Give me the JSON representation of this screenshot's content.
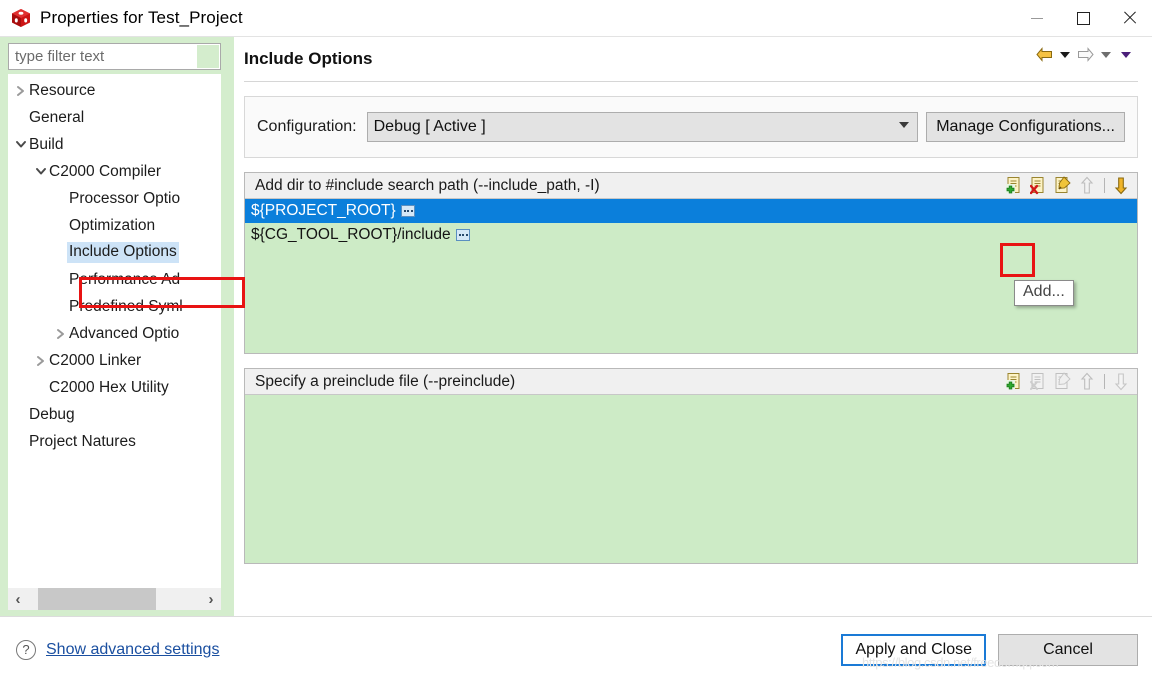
{
  "window": {
    "title": "Properties for Test_Project",
    "app_icon": "red-cube-icon",
    "controls": {
      "minimize": "minimize-icon",
      "maximize": "maximize-icon",
      "close": "close-icon"
    }
  },
  "sidebar": {
    "filter": {
      "placeholder": "type filter text",
      "value": ""
    },
    "tree": [
      {
        "label": "Resource",
        "indent": 0,
        "arrow": "collapsed",
        "selected": false
      },
      {
        "label": "General",
        "indent": 0,
        "arrow": "none",
        "selected": false
      },
      {
        "label": "Build",
        "indent": 0,
        "arrow": "expanded",
        "selected": false
      },
      {
        "label": "C2000 Compiler",
        "indent": 1,
        "arrow": "expanded",
        "selected": false
      },
      {
        "label": "Processor Optio",
        "indent": 2,
        "arrow": "none",
        "selected": false
      },
      {
        "label": "Optimization",
        "indent": 2,
        "arrow": "none",
        "selected": false
      },
      {
        "label": "Include Options",
        "indent": 2,
        "arrow": "none",
        "selected": true
      },
      {
        "label": "Performance Ad",
        "indent": 2,
        "arrow": "none",
        "selected": false
      },
      {
        "label": "Predefined Syml",
        "indent": 2,
        "arrow": "none",
        "selected": false
      },
      {
        "label": "Advanced Optio",
        "indent": 2,
        "arrow": "collapsed",
        "selected": false
      },
      {
        "label": "C2000 Linker",
        "indent": 1,
        "arrow": "collapsed",
        "selected": false
      },
      {
        "label": "C2000 Hex Utility",
        "indent": 1,
        "arrow": "none",
        "selected": false
      },
      {
        "label": "Debug",
        "indent": 0,
        "arrow": "none",
        "selected": false
      },
      {
        "label": "Project Natures",
        "indent": 0,
        "arrow": "none",
        "selected": false
      }
    ],
    "scrollbar": {
      "left_arrow": "‹",
      "right_arrow": "›"
    }
  },
  "page": {
    "title": "Include Options",
    "nav": {
      "back": "back-arrow-icon",
      "back_menu": "chevron-down-icon",
      "forward": "forward-arrow-icon",
      "forward_menu": "chevron-down-icon",
      "view_menu": "chevron-down-icon"
    }
  },
  "configuration": {
    "label": "Configuration:",
    "selected": "Debug  [ Active ]",
    "options": [
      "Debug  [ Active ]"
    ],
    "manage_button": "Manage Configurations..."
  },
  "groups": [
    {
      "header": "Add dir to #include search path (--include_path, -I)",
      "toolbar": [
        {
          "name": "add-icon",
          "enabled": true
        },
        {
          "name": "delete-icon",
          "enabled": true
        },
        {
          "name": "edit-icon",
          "enabled": true
        },
        {
          "name": "move-up-icon",
          "enabled": false
        },
        {
          "name": "move-down-icon",
          "enabled": true
        }
      ],
      "items": [
        {
          "text": "${PROJECT_ROOT}",
          "selected": true,
          "badge": "variable-icon"
        },
        {
          "text": "${CG_TOOL_ROOT}/include",
          "selected": false,
          "badge": "variable-icon"
        }
      ]
    },
    {
      "header": "Specify a preinclude file (--preinclude)",
      "toolbar": [
        {
          "name": "add-icon",
          "enabled": true
        },
        {
          "name": "delete-icon",
          "enabled": false
        },
        {
          "name": "edit-icon",
          "enabled": false
        },
        {
          "name": "move-up-icon",
          "enabled": false
        },
        {
          "name": "move-down-icon",
          "enabled": false
        }
      ],
      "items": []
    }
  ],
  "tooltip": {
    "text": "Add..."
  },
  "annotations": {
    "tree_highlight": "#e81313",
    "add_button_highlight": "#e81313"
  },
  "footer": {
    "help_icon": "question-mark-icon",
    "advanced_link": "Show advanced settings",
    "apply_button": "Apply and Close",
    "cancel_button": "Cancel"
  },
  "watermark": {
    "text": "https://blog.csdn.net/freedomqq.com"
  },
  "colors": {
    "list_background": "#cdebc6",
    "selection_blue": "#0b7fdb",
    "sidebar_background": "#d4edcd",
    "tree_selection": "#cde3f7",
    "focus_border": "#1a7ad6",
    "annotation_red": "#e81313"
  }
}
